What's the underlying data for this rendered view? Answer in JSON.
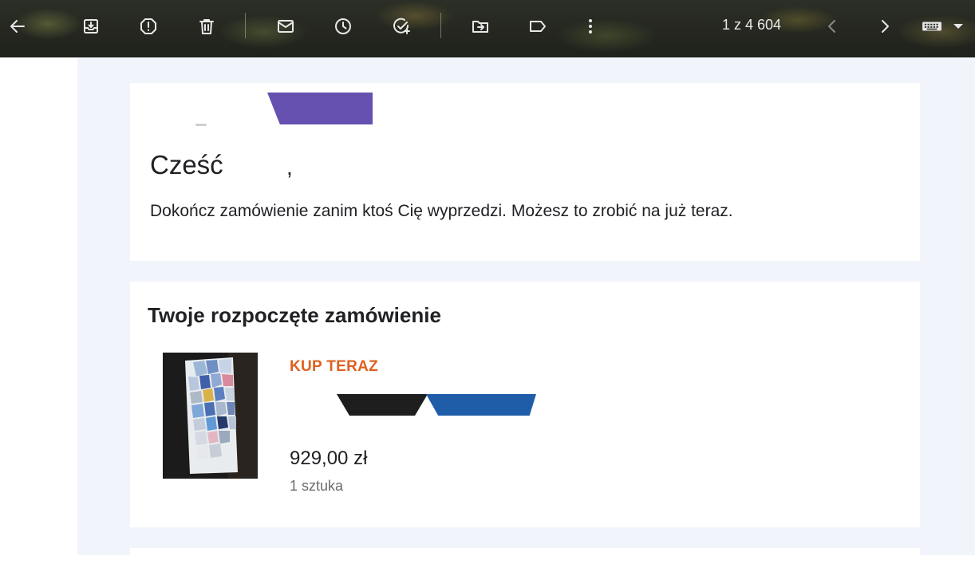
{
  "toolbar": {
    "icons": [
      "back-arrow-icon",
      "archive-icon",
      "report-spam-icon",
      "delete-icon",
      "mark-unread-icon",
      "snooze-icon",
      "add-task-icon",
      "move-to-icon",
      "label-icon",
      "more-vert-icon",
      "older-chevron-icon",
      "newer-chevron-icon",
      "keyboard-icon",
      "dropdown-arrow-icon"
    ],
    "counter": "1 z 4 604"
  },
  "email": {
    "greeting": "Cześć",
    "greeting_comma": ",",
    "intro": "Dokończ zamówienie zanim ktoś Cię wyprzedzi. Możesz to zrobić na już teraz.",
    "section_title": "Twoje rozpoczęte zamówienie",
    "product": {
      "buy_label": "KUP TERAZ",
      "price": "929,00 zł",
      "quantity": "1 sztuka"
    }
  },
  "colors": {
    "accent_orange": "#e0601e",
    "logo_purple": "#6650b0",
    "band_blue": "#1f5da8",
    "mail_background": "#f1f5fb"
  }
}
